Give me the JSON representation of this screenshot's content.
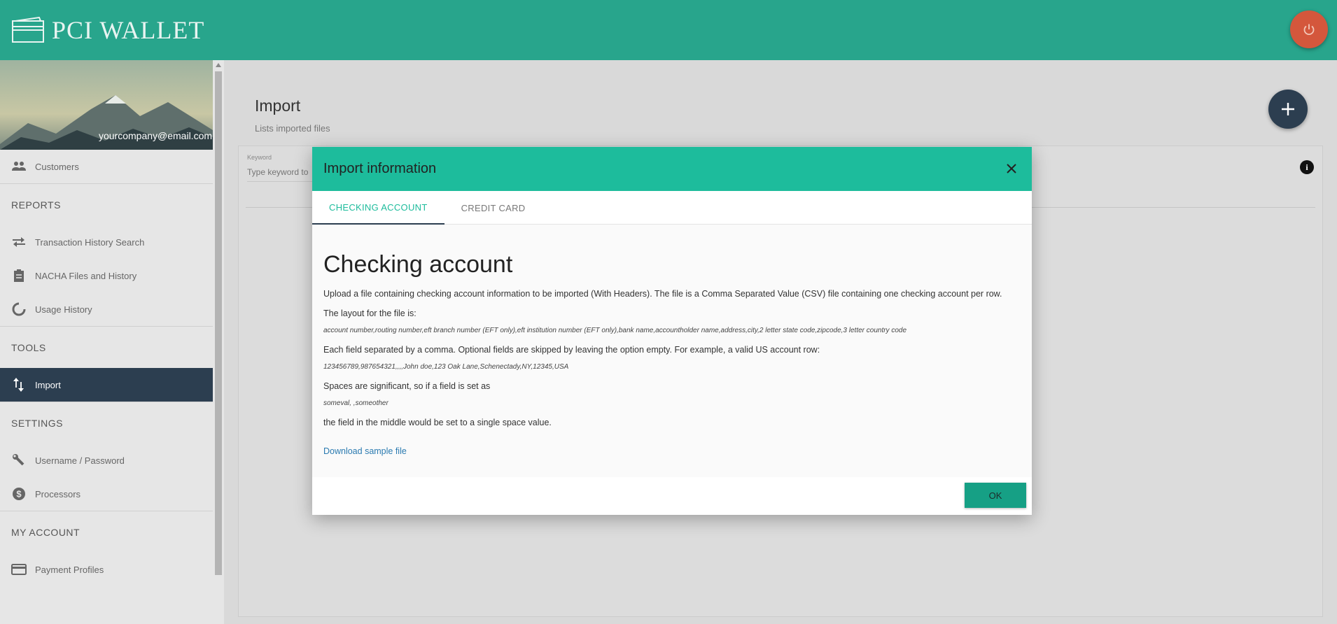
{
  "app": {
    "logo_text": "PCI WALLET"
  },
  "colors": {
    "header": "#28a58c",
    "accent": "#1dbc9c",
    "active_nav": "#2c3e50",
    "power": "#d4573c",
    "link": "#2a7ab0"
  },
  "sidebar": {
    "email": "yourcompany@email.com",
    "items": {
      "customers": "Customers",
      "reports_title": "REPORTS",
      "transaction_history": "Transaction History Search",
      "nacha": "NACHA Files and History",
      "usage": "Usage History",
      "tools_title": "TOOLS",
      "import": "Import",
      "settings_title": "SETTINGS",
      "username_password": "Username / Password",
      "processors": "Processors",
      "account_title": "MY ACCOUNT",
      "payment_profiles": "Payment Profiles"
    }
  },
  "main": {
    "title": "Import",
    "subtitle": "Lists imported files",
    "keyword_label": "Keyword",
    "keyword_placeholder": "Type keyword to"
  },
  "modal": {
    "title": "Import information",
    "tabs": [
      "CHECKING ACCOUNT",
      "CREDIT CARD"
    ],
    "heading": "Checking account",
    "p1": "Upload a file containing checking account information to be imported (With Headers). The file is a Comma Separated Value (CSV) file containing one checking account per row.",
    "p2": "The layout for the file is:",
    "layout": "account number,routing number,eft branch number (EFT only),eft institution number (EFT only),bank name,accountholder name,address,city,2 letter state code,zipcode,3 letter country code",
    "p3": "Each field separated by a comma. Optional fields are skipped by leaving the option empty. For example, a valid US account row:",
    "example": "123456789,987654321,,,,John doe,123 Oak Lane,Schenectady,NY,12345,USA",
    "p4": "Spaces are significant, so if a field is set as",
    "spaces_example": "someval, ,someother",
    "p5": "the field in the middle would be set to a single space value.",
    "download_link": "Download sample file",
    "ok_label": "OK"
  }
}
